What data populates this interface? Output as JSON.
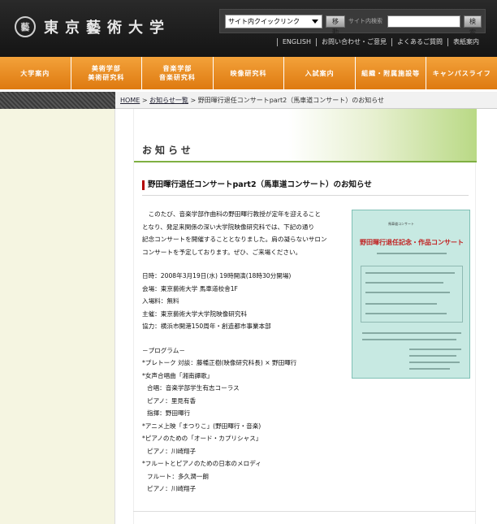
{
  "header": {
    "logo_mark": "藝",
    "logo_text": "東京藝術大学",
    "quicklink": "サイト内クイックリンク",
    "go_button": "移動",
    "site_search_label": "サイト内検索",
    "search_button": "検索",
    "util_links": [
      "ENGLISH",
      "お問い合わせ・ご意見",
      "よくあるご質問",
      "表紙案内"
    ]
  },
  "nav": {
    "items": [
      "大学案内",
      "美術学部\n美術研究科",
      "音楽学部\n音楽研究科",
      "映像研究科",
      "入試案内",
      "組織・附属施設等",
      "キャンパスライフ"
    ]
  },
  "breadcrumb": {
    "home": "HOME",
    "sep": " > ",
    "news": "お知らせ一覧",
    "current": "野田暉行退任コンサートpart2（馬車道コンサート）のお知らせ"
  },
  "content": {
    "banner_title": "お知らせ",
    "article_title": "野田暉行退任コンサートpart2（馬車道コンサート）のお知らせ",
    "intro_lines": [
      "　このたび、音楽学部作曲科の野田暉行教授が定年を迎えること",
      "となり、発足来関係の深い大学院映像研究科では、下記の通り",
      "記念コンサートを開催することとなりました。肩の凝らないサロン",
      "コンサートを予定しております。ぜひ、ご来場ください。"
    ],
    "details": [
      "日時：2008年3月19日(水) 19時開演(18時30分開場)",
      "会場：東京藝術大学 馬車道校舎1F",
      "入場料：無料",
      "主催：東京藝術大学大学院映像研究科",
      "協力：横浜市開港150周年・創造都市事業本部"
    ],
    "program_heading": "－プログラム－",
    "program": [
      "*プレトーク 対談：藤幡正樹(映像研究科長) × 野田暉行",
      "*女声合唱曲「湘南譚歌」",
      "  合唱：音楽学部学生有志コーラス",
      "  ピアノ：里見有香",
      "  指揮：野田暉行",
      "*アニメ上映「まつりこ」(野田暉行・音楽)",
      "*ピアノのための「オード・カプリシャス」",
      "  ピアノ：川崎翔子",
      "*フルートとピアノのための日本のメロディ",
      "  フルート：多久潤一朗",
      "  ピアノ：川崎翔子"
    ],
    "poster": {
      "label": "馬車道コンサート",
      "title": "野田暉行退任記念・作品コンサート"
    }
  }
}
